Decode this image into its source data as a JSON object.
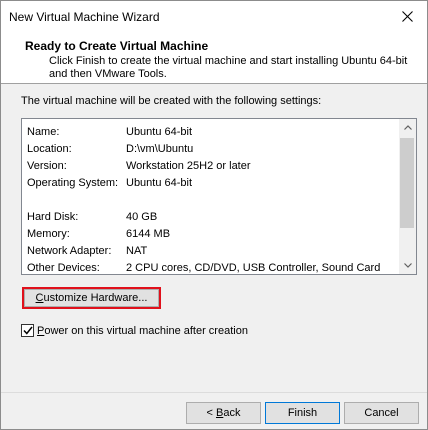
{
  "window": {
    "title": "New Virtual Machine Wizard",
    "close_icon": "close-icon"
  },
  "header": {
    "title": "Ready to Create Virtual Machine",
    "description": "Click Finish to create the virtual machine and start installing Ubuntu 64-bit and then VMware Tools."
  },
  "intro": "The virtual machine will be created with the following settings:",
  "settings": [
    {
      "key": "Name:",
      "value": "Ubuntu 64-bit"
    },
    {
      "key": "Location:",
      "value": "D:\\vm\\Ubuntu"
    },
    {
      "key": "Version:",
      "value": "Workstation 25H2 or later"
    },
    {
      "key": "Operating System:",
      "value": "Ubuntu 64-bit"
    },
    {
      "key": "",
      "value": ""
    },
    {
      "key": "Hard Disk:",
      "value": "40 GB"
    },
    {
      "key": "Memory:",
      "value": "6144 MB"
    },
    {
      "key": "Network Adapter:",
      "value": "NAT"
    },
    {
      "key": "Other Devices:",
      "value": "2 CPU cores, CD/DVD, USB Controller, Sound Card"
    }
  ],
  "customize_button": {
    "label_prefix": "",
    "label_underlined": "C",
    "label_rest": "ustomize Hardware..."
  },
  "power_checkbox": {
    "checked": true,
    "label_underlined": "P",
    "label_rest": "ower on this virtual machine after creation"
  },
  "buttons": {
    "back": {
      "prefix": "< ",
      "underlined": "B",
      "rest": "ack"
    },
    "finish": "Finish",
    "cancel": "Cancel"
  },
  "colors": {
    "highlight_border": "#e0101b",
    "default_button_border": "#0078d7"
  }
}
